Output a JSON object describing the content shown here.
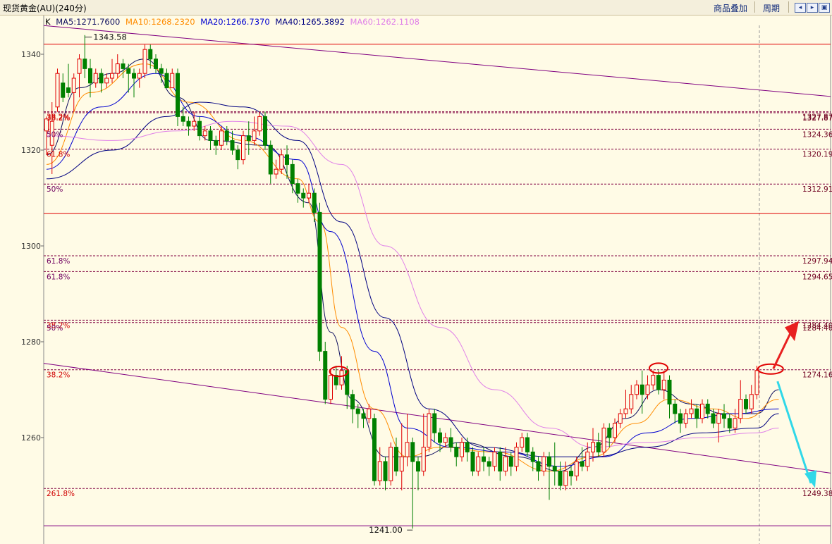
{
  "header": {
    "title": "现货黄金(AU)(240分)",
    "overlay_label": "商品叠加",
    "period_label": "周期",
    "icons": [
      "arrow-left-icon",
      "arrow-right-icon",
      "restore-icon"
    ]
  },
  "legend": {
    "k": "K",
    "ma5": "MA5:1271.7600",
    "ma10": "MA10:1268.2320",
    "ma20": "MA20:1266.7370",
    "ma40": "MA40:1265.3892",
    "ma60": "MA60:1262.1108",
    "colors": {
      "ma5": "#101060",
      "ma10": "#ff8c00",
      "ma20": "#0000d0",
      "ma40": "#000080",
      "ma60": "#e080e8"
    }
  },
  "chart_data": {
    "type": "candlestick",
    "ylim": [
      1238,
      1344
    ],
    "y_ticks": [
      1340,
      1320,
      1300,
      1280,
      1260
    ],
    "colors": {
      "up": "#e00000",
      "down": "#008000",
      "up_fill": "#fffbe6"
    },
    "high_label": "1343.58",
    "low_label": "1241.00",
    "solid_levels": [
      1342.1,
      1306.8,
      1241.6
    ],
    "fib_levels": [
      {
        "price": 1328.0,
        "left": "38.2%",
        "right": "1327.87"
      },
      {
        "price": 1327.8,
        "left": "38.2%",
        "right": "1327.87"
      },
      {
        "price": 1324.36,
        "left": "50%",
        "right": "1324.36"
      },
      {
        "price": 1320.19,
        "left": "61.8%",
        "right": "1320.19"
      },
      {
        "price": 1312.91,
        "left": "50%",
        "right": "1312.91"
      },
      {
        "price": 1297.94,
        "left": "61.8%",
        "right": "1297.94"
      },
      {
        "price": 1294.65,
        "left": "61.8%",
        "right": "1294.65"
      },
      {
        "price": 1284.5,
        "left": "38.2%",
        "right": "1284.40"
      },
      {
        "price": 1284.0,
        "left": "50%",
        "right": "1284.40"
      },
      {
        "price": 1274.16,
        "left": "38.2%",
        "right": "1274.16"
      },
      {
        "price": 1249.38,
        "left": "261.8%",
        "right": "1249.38"
      }
    ],
    "trendlines": [
      {
        "name": "upper-channel",
        "from": [
          0,
          1346
        ],
        "to": [
          1,
          1331.2
        ]
      },
      {
        "name": "lower-channel",
        "from": [
          0,
          1275.5
        ],
        "to": [
          1,
          1252.6
        ]
      }
    ],
    "candles": [
      [
        1324.0,
        1326.5,
        1319.0,
        1327.0
      ],
      [
        1321.0,
        1326.0,
        1315.0,
        1330.0
      ],
      [
        1329.0,
        1336.0,
        1328.0,
        1337.0
      ],
      [
        1334.0,
        1331.0,
        1330.0,
        1336.0
      ],
      [
        1333.0,
        1332.0,
        1331.0,
        1338.0
      ],
      [
        1332.0,
        1335.0,
        1328.0,
        1336.0
      ],
      [
        1336.0,
        1339.0,
        1331.0,
        1340.0
      ],
      [
        1339.0,
        1337.0,
        1335.0,
        1344.0
      ],
      [
        1337.0,
        1334.0,
        1331.0,
        1339.0
      ],
      [
        1334.0,
        1336.0,
        1333.0,
        1337.0
      ],
      [
        1336.0,
        1334.0,
        1332.0,
        1337.0
      ],
      [
        1334.0,
        1335.0,
        1333.0,
        1336.0
      ],
      [
        1335.0,
        1336.0,
        1334.0,
        1339.0
      ],
      [
        1336.0,
        1338.0,
        1335.0,
        1340.0
      ],
      [
        1338.0,
        1337.0,
        1335.0,
        1339.0
      ],
      [
        1337.0,
        1336.0,
        1332.0,
        1338.0
      ],
      [
        1336.0,
        1335.0,
        1331.0,
        1337.0
      ],
      [
        1335.0,
        1336.0,
        1333.0,
        1337.0
      ],
      [
        1336.0,
        1341.0,
        1335.0,
        1342.0
      ],
      [
        1341.0,
        1339.0,
        1337.0,
        1342.0
      ],
      [
        1339.0,
        1337.0,
        1336.0,
        1340.0
      ],
      [
        1337.0,
        1336.0,
        1334.0,
        1338.0
      ],
      [
        1336.0,
        1333.0,
        1333.0,
        1337.0
      ],
      [
        1333.0,
        1336.0,
        1333.0,
        1337.0
      ],
      [
        1336.0,
        1327.0,
        1325.0,
        1337.0
      ],
      [
        1327.0,
        1326.0,
        1325.0,
        1329.0
      ],
      [
        1326.0,
        1325.0,
        1323.0,
        1327.0
      ],
      [
        1325.0,
        1326.0,
        1324.0,
        1328.0
      ],
      [
        1326.0,
        1323.0,
        1322.0,
        1327.0
      ],
      [
        1323.0,
        1324.0,
        1322.0,
        1325.0
      ],
      [
        1324.0,
        1322.0,
        1320.0,
        1325.0
      ],
      [
        1322.0,
        1321.0,
        1319.0,
        1323.0
      ],
      [
        1321.0,
        1324.0,
        1320.0,
        1325.0
      ],
      [
        1324.0,
        1322.0,
        1321.0,
        1325.0
      ],
      [
        1322.0,
        1320.0,
        1319.0,
        1324.0
      ],
      [
        1320.0,
        1318.0,
        1316.0,
        1321.0
      ],
      [
        1318.0,
        1323.0,
        1317.0,
        1324.0
      ],
      [
        1323.0,
        1322.0,
        1319.0,
        1326.0
      ],
      [
        1322.0,
        1324.0,
        1321.0,
        1327.0
      ],
      [
        1324.0,
        1327.0,
        1323.0,
        1328.0
      ],
      [
        1327.0,
        1321.0,
        1320.0,
        1328.0
      ],
      [
        1321.0,
        1315.0,
        1313.0,
        1322.0
      ],
      [
        1315.0,
        1316.0,
        1314.0,
        1318.0
      ],
      [
        1316.0,
        1319.0,
        1315.0,
        1320.0
      ],
      [
        1319.0,
        1317.0,
        1314.0,
        1321.0
      ],
      [
        1317.0,
        1313.0,
        1311.0,
        1318.0
      ],
      [
        1313.0,
        1311.0,
        1309.0,
        1314.0
      ],
      [
        1311.0,
        1310.0,
        1308.0,
        1312.0
      ],
      [
        1310.0,
        1311.0,
        1309.0,
        1313.0
      ],
      [
        1311.0,
        1307.0,
        1305.0,
        1312.0
      ],
      [
        1307.0,
        1278.0,
        1276.0,
        1309.0
      ],
      [
        1278.0,
        1268.0,
        1267.0,
        1280.0
      ],
      [
        1268.0,
        1273.0,
        1267.0,
        1274.0
      ],
      [
        1273.0,
        1271.0,
        1270.0,
        1275.0
      ],
      [
        1271.0,
        1274.0,
        1270.0,
        1277.0
      ],
      [
        1274.0,
        1269.0,
        1266.0,
        1275.0
      ],
      [
        1269.0,
        1266.0,
        1263.0,
        1270.0
      ],
      [
        1266.0,
        1265.0,
        1262.0,
        1267.0
      ],
      [
        1265.0,
        1264.0,
        1262.0,
        1266.0
      ],
      [
        1264.0,
        1266.0,
        1263.0,
        1267.0
      ],
      [
        1264.0,
        1251.0,
        1250.0,
        1265.0
      ],
      [
        1251.0,
        1255.0,
        1250.0,
        1258.0
      ],
      [
        1255.0,
        1251.0,
        1249.0,
        1256.0
      ],
      [
        1251.0,
        1258.0,
        1250.0,
        1259.0
      ],
      [
        1258.0,
        1253.0,
        1252.0,
        1260.0
      ],
      [
        1253.0,
        1256.0,
        1249.0,
        1263.0
      ],
      [
        1256.0,
        1259.0,
        1254.0,
        1265.0
      ],
      [
        1259.0,
        1255.0,
        1241.0,
        1260.0
      ],
      [
        1255.0,
        1253.0,
        1249.0,
        1256.0
      ],
      [
        1253.0,
        1258.0,
        1252.0,
        1265.0
      ],
      [
        1258.0,
        1265.0,
        1257.0,
        1266.0
      ],
      [
        1265.0,
        1261.0,
        1259.0,
        1266.0
      ],
      [
        1261.0,
        1259.0,
        1257.0,
        1262.0
      ],
      [
        1259.0,
        1260.0,
        1258.0,
        1261.0
      ],
      [
        1260.0,
        1258.0,
        1257.0,
        1262.0
      ],
      [
        1258.0,
        1256.0,
        1254.0,
        1259.0
      ],
      [
        1256.0,
        1259.0,
        1255.0,
        1260.0
      ],
      [
        1259.0,
        1257.0,
        1255.0,
        1260.0
      ],
      [
        1257.0,
        1253.0,
        1252.0,
        1258.0
      ],
      [
        1253.0,
        1256.0,
        1252.0,
        1257.0
      ],
      [
        1256.0,
        1255.0,
        1253.0,
        1258.0
      ],
      [
        1255.0,
        1254.0,
        1252.0,
        1256.0
      ],
      [
        1254.0,
        1257.0,
        1253.0,
        1258.0
      ],
      [
        1257.0,
        1253.0,
        1251.0,
        1258.0
      ],
      [
        1253.0,
        1256.0,
        1252.0,
        1258.0
      ],
      [
        1256.0,
        1254.0,
        1252.0,
        1257.0
      ],
      [
        1254.0,
        1258.0,
        1253.0,
        1259.0
      ],
      [
        1258.0,
        1260.0,
        1257.0,
        1261.0
      ],
      [
        1260.0,
        1257.0,
        1256.0,
        1261.0
      ],
      [
        1257.0,
        1255.0,
        1253.0,
        1258.0
      ],
      [
        1255.0,
        1253.0,
        1251.0,
        1256.0
      ],
      [
        1253.0,
        1256.0,
        1252.0,
        1257.0
      ],
      [
        1256.0,
        1254.0,
        1247.0,
        1257.0
      ],
      [
        1254.0,
        1253.0,
        1250.0,
        1259.0
      ],
      [
        1253.0,
        1250.0,
        1249.0,
        1255.0
      ],
      [
        1250.0,
        1253.0,
        1249.0,
        1255.0
      ],
      [
        1253.0,
        1252.0,
        1250.0,
        1254.0
      ],
      [
        1252.0,
        1255.0,
        1251.0,
        1256.0
      ],
      [
        1255.0,
        1254.0,
        1253.0,
        1258.0
      ],
      [
        1254.0,
        1257.0,
        1253.0,
        1259.0
      ],
      [
        1257.0,
        1259.0,
        1255.0,
        1262.0
      ],
      [
        1259.0,
        1257.0,
        1256.0,
        1261.0
      ],
      [
        1257.0,
        1262.0,
        1256.0,
        1263.0
      ],
      [
        1262.0,
        1260.0,
        1258.0,
        1263.0
      ],
      [
        1260.0,
        1263.0,
        1259.0,
        1264.0
      ],
      [
        1263.0,
        1265.0,
        1262.0,
        1266.0
      ],
      [
        1265.0,
        1266.0,
        1264.0,
        1270.0
      ],
      [
        1266.0,
        1269.0,
        1265.0,
        1271.0
      ],
      [
        1269.0,
        1271.0,
        1268.0,
        1272.0
      ],
      [
        1271.0,
        1269.0,
        1265.0,
        1274.0
      ],
      [
        1269.0,
        1271.0,
        1268.0,
        1273.0
      ],
      [
        1271.0,
        1273.0,
        1270.0,
        1274.0
      ],
      [
        1273.0,
        1270.0,
        1269.0,
        1274.0
      ],
      [
        1270.0,
        1272.0,
        1268.0,
        1274.0
      ],
      [
        1272.0,
        1267.0,
        1264.0,
        1273.0
      ],
      [
        1267.0,
        1265.0,
        1263.0,
        1268.0
      ],
      [
        1265.0,
        1263.0,
        1261.0,
        1266.0
      ],
      [
        1263.0,
        1265.0,
        1262.0,
        1266.0
      ],
      [
        1265.0,
        1266.0,
        1264.0,
        1268.0
      ],
      [
        1266.0,
        1264.0,
        1262.0,
        1267.0
      ],
      [
        1264.0,
        1267.0,
        1263.0,
        1268.0
      ],
      [
        1267.0,
        1265.0,
        1264.0,
        1268.0
      ],
      [
        1265.0,
        1263.0,
        1262.0,
        1266.0
      ],
      [
        1263.0,
        1265.0,
        1259.0,
        1266.0
      ],
      [
        1265.0,
        1264.0,
        1262.0,
        1267.0
      ],
      [
        1264.0,
        1262.0,
        1261.0,
        1265.0
      ],
      [
        1262.0,
        1264.0,
        1261.0,
        1266.0
      ],
      [
        1264.0,
        1268.0,
        1263.0,
        1272.0
      ],
      [
        1268.0,
        1266.0,
        1265.0,
        1269.0
      ],
      [
        1266.0,
        1269.0,
        1265.0,
        1271.0
      ],
      [
        1269.0,
        1274.0,
        1268.0,
        1275.0
      ]
    ],
    "ma_series": [
      {
        "name": "MA5",
        "color": "#101060",
        "points": [
          [
            0,
            1319
          ],
          [
            6,
            1333
          ],
          [
            12,
            1336
          ],
          [
            18,
            1339
          ],
          [
            24,
            1331
          ],
          [
            30,
            1322
          ],
          [
            40,
            1321
          ],
          [
            48,
            1309
          ],
          [
            52,
            1282
          ],
          [
            56,
            1268
          ],
          [
            62,
            1256
          ],
          [
            68,
            1256
          ],
          [
            76,
            1259
          ],
          [
            86,
            1256
          ],
          [
            94,
            1253
          ],
          [
            100,
            1258
          ],
          [
            106,
            1264
          ],
          [
            112,
            1270
          ],
          [
            118,
            1267
          ],
          [
            124,
            1265
          ],
          [
            130,
            1265
          ],
          [
            134,
            1270
          ]
        ]
      },
      {
        "name": "MA10",
        "color": "#ff8c00",
        "points": [
          [
            0,
            1317
          ],
          [
            8,
            1332
          ],
          [
            18,
            1338
          ],
          [
            26,
            1330
          ],
          [
            36,
            1322
          ],
          [
            46,
            1314
          ],
          [
            50,
            1305
          ],
          [
            54,
            1283
          ],
          [
            60,
            1266
          ],
          [
            66,
            1256
          ],
          [
            72,
            1258
          ],
          [
            82,
            1257
          ],
          [
            92,
            1253
          ],
          [
            100,
            1256
          ],
          [
            108,
            1263
          ],
          [
            114,
            1268
          ],
          [
            122,
            1266
          ],
          [
            128,
            1264
          ],
          [
            134,
            1268
          ]
        ]
      },
      {
        "name": "MA20",
        "color": "#0000d0",
        "points": [
          [
            0,
            1316
          ],
          [
            10,
            1329
          ],
          [
            20,
            1336
          ],
          [
            28,
            1327
          ],
          [
            36,
            1323
          ],
          [
            46,
            1318
          ],
          [
            52,
            1303
          ],
          [
            60,
            1278
          ],
          [
            66,
            1262
          ],
          [
            74,
            1258
          ],
          [
            84,
            1257
          ],
          [
            94,
            1254
          ],
          [
            102,
            1256
          ],
          [
            110,
            1261
          ],
          [
            118,
            1264
          ],
          [
            126,
            1265
          ],
          [
            134,
            1266
          ]
        ]
      },
      {
        "name": "MA40",
        "color": "#000080",
        "points": [
          [
            0,
            1314
          ],
          [
            12,
            1320
          ],
          [
            22,
            1327
          ],
          [
            28,
            1330
          ],
          [
            36,
            1329
          ],
          [
            46,
            1322
          ],
          [
            54,
            1305
          ],
          [
            62,
            1285
          ],
          [
            70,
            1266
          ],
          [
            80,
            1258
          ],
          [
            92,
            1256
          ],
          [
            100,
            1256
          ],
          [
            110,
            1258
          ],
          [
            120,
            1261
          ],
          [
            130,
            1262
          ],
          [
            134,
            1265
          ]
        ]
      },
      {
        "name": "MA60",
        "color": "#e080e8",
        "points": [
          [
            0,
            1323
          ],
          [
            12,
            1322
          ],
          [
            24,
            1324
          ],
          [
            34,
            1326
          ],
          [
            44,
            1325
          ],
          [
            54,
            1317
          ],
          [
            62,
            1300
          ],
          [
            72,
            1283
          ],
          [
            82,
            1270
          ],
          [
            92,
            1262
          ],
          [
            100,
            1258
          ],
          [
            110,
            1259
          ],
          [
            120,
            1260
          ],
          [
            130,
            1261
          ],
          [
            134,
            1262
          ]
        ]
      }
    ]
  }
}
